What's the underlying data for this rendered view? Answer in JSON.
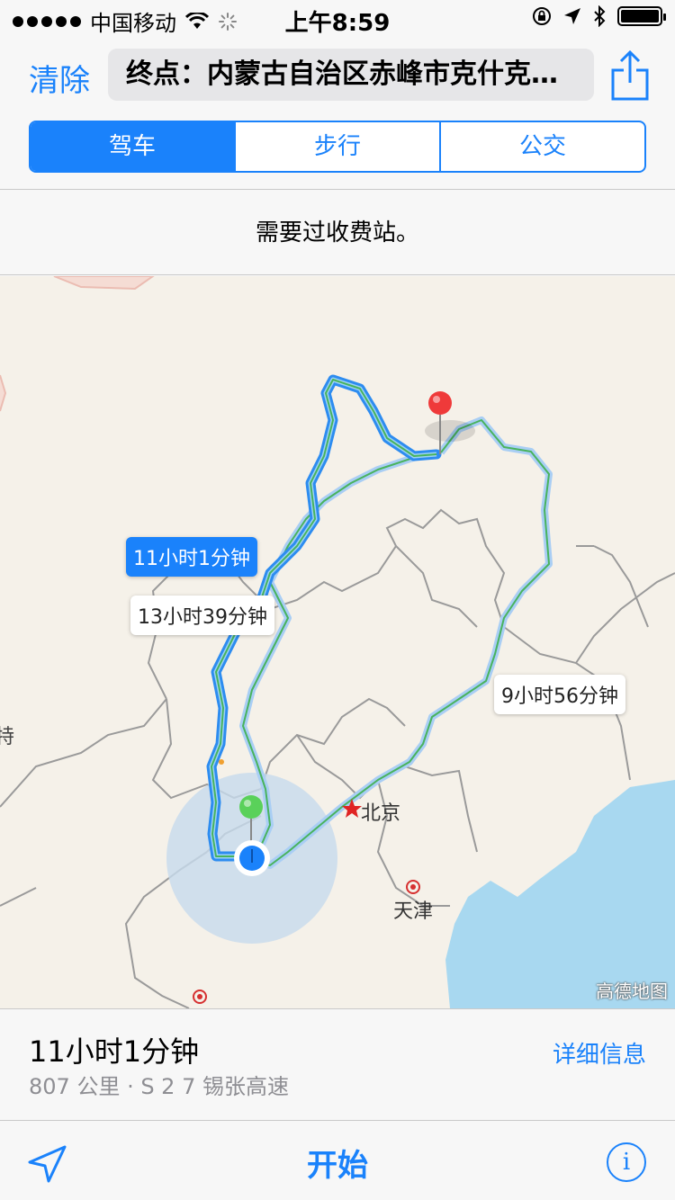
{
  "status_bar": {
    "carrier": "中国移动",
    "time": "上午8:59"
  },
  "nav": {
    "clear_label": "清除",
    "destination": "终点：内蒙古自治区赤峰市克什克…"
  },
  "tabs": [
    {
      "label": "驾车",
      "active": true
    },
    {
      "label": "步行",
      "active": false
    },
    {
      "label": "公交",
      "active": false
    }
  ],
  "toll_notice": "需要过收费站。",
  "map": {
    "routes": [
      {
        "label": "11小时1分钟",
        "selected": true
      },
      {
        "label": "13小时39分钟",
        "selected": false
      },
      {
        "label": "9小时56分钟",
        "selected": false
      }
    ],
    "cities": [
      "北京",
      "天津"
    ],
    "edge_text": "特",
    "watermark": "高德地图"
  },
  "route_info": {
    "duration": "11小时1分钟",
    "distance_road": "807 公里 · S 2 7 锡张高速",
    "details_label": "详细信息"
  },
  "bottom": {
    "start_label": "开始"
  },
  "colors": {
    "accent": "#1a82fb",
    "route_selected": "#2d8cf0",
    "route_alt": "#a9cef4",
    "route_line": "#48b35d",
    "water": "#a8d8f0",
    "land": "#f5f1e9",
    "border": "#9a9a9a"
  }
}
